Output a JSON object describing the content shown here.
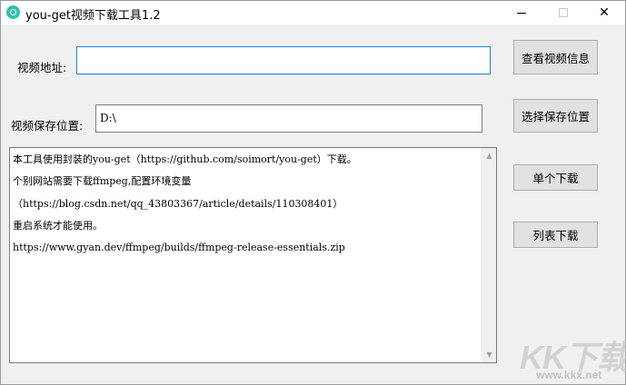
{
  "window": {
    "title": "you-get视频下载工具1.2",
    "minimize_glyph": "—",
    "maximize_glyph": "☐",
    "close_glyph": "✕"
  },
  "form": {
    "url_label": "视频地址:",
    "url_value": "",
    "save_label": "视频保存位置:",
    "save_value": "D:\\"
  },
  "buttons": {
    "view_info": "查看视频信息",
    "choose_location": "选择保存位置",
    "single_download": "单个下载",
    "list_download": "列表下载"
  },
  "log": {
    "lines": [
      "本工具使用封装的you-get（https://github.com/soimort/you-get）下载。",
      "个别网站需要下载ffmpeg,配置环境变量",
      "（https://blog.csdn.net/qq_43803367/article/details/110308401）",
      "重启系统才能使用。",
      "https://www.gyan.dev/ffmpeg/builds/ffmpeg-release-essentials.zip"
    ]
  },
  "scrollbar": {
    "up_glyph": "▲",
    "down_glyph": "▼"
  },
  "watermark": {
    "text": "KK下载",
    "url": "www.kkx.net"
  },
  "colors": {
    "app_icon": "#2fc3a8",
    "focus_border": "#1e7fd0",
    "button_bg": "#e1e1e1",
    "window_bg": "#f0f0f0"
  },
  "icons": {
    "app": "app-logo-icon"
  }
}
